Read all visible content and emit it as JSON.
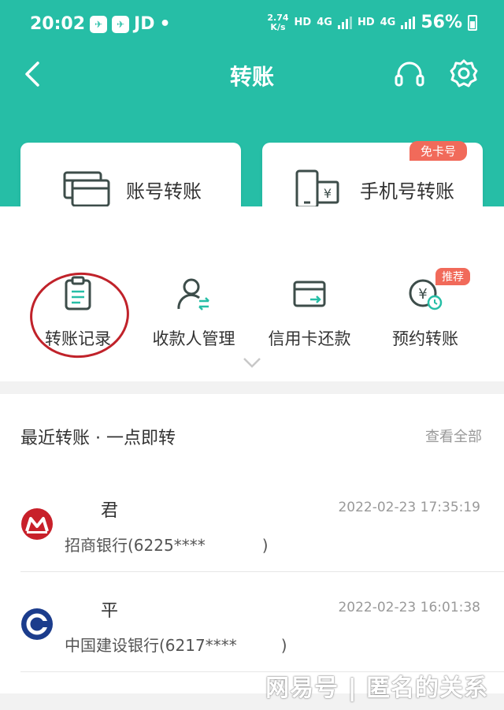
{
  "status_bar": {
    "time": "20:02",
    "carrier": "JD",
    "speed_value": "2.74",
    "speed_unit": "K/s",
    "hd1": "HD",
    "net1": "4G",
    "hd2": "HD",
    "net2": "4G",
    "battery": "56%"
  },
  "nav": {
    "title": "转账"
  },
  "cards": {
    "account_transfer": "账号转账",
    "phone_transfer": "手机号转账",
    "phone_badge": "免卡号"
  },
  "quick_actions": [
    {
      "label": "转账记录"
    },
    {
      "label": "收款人管理"
    },
    {
      "label": "信用卡还款"
    },
    {
      "label": "预约转账",
      "badge": "推荐"
    }
  ],
  "recent": {
    "title": "最近转账 · 一点即转",
    "view_all": "查看全部",
    "items": [
      {
        "name": "君",
        "bank": "招商银行(6225****",
        "bank_suffix": ")",
        "time": "2022-02-23 17:35:19"
      },
      {
        "name": "平",
        "bank": "中国建设银行(6217****",
        "bank_suffix": ")",
        "time": "2022-02-23 16:01:38"
      }
    ]
  },
  "watermark": "网易号 | 匿名的关系",
  "colors": {
    "brand": "#26bea6",
    "badge": "#f16a5a",
    "annotation": "#c0222a"
  }
}
